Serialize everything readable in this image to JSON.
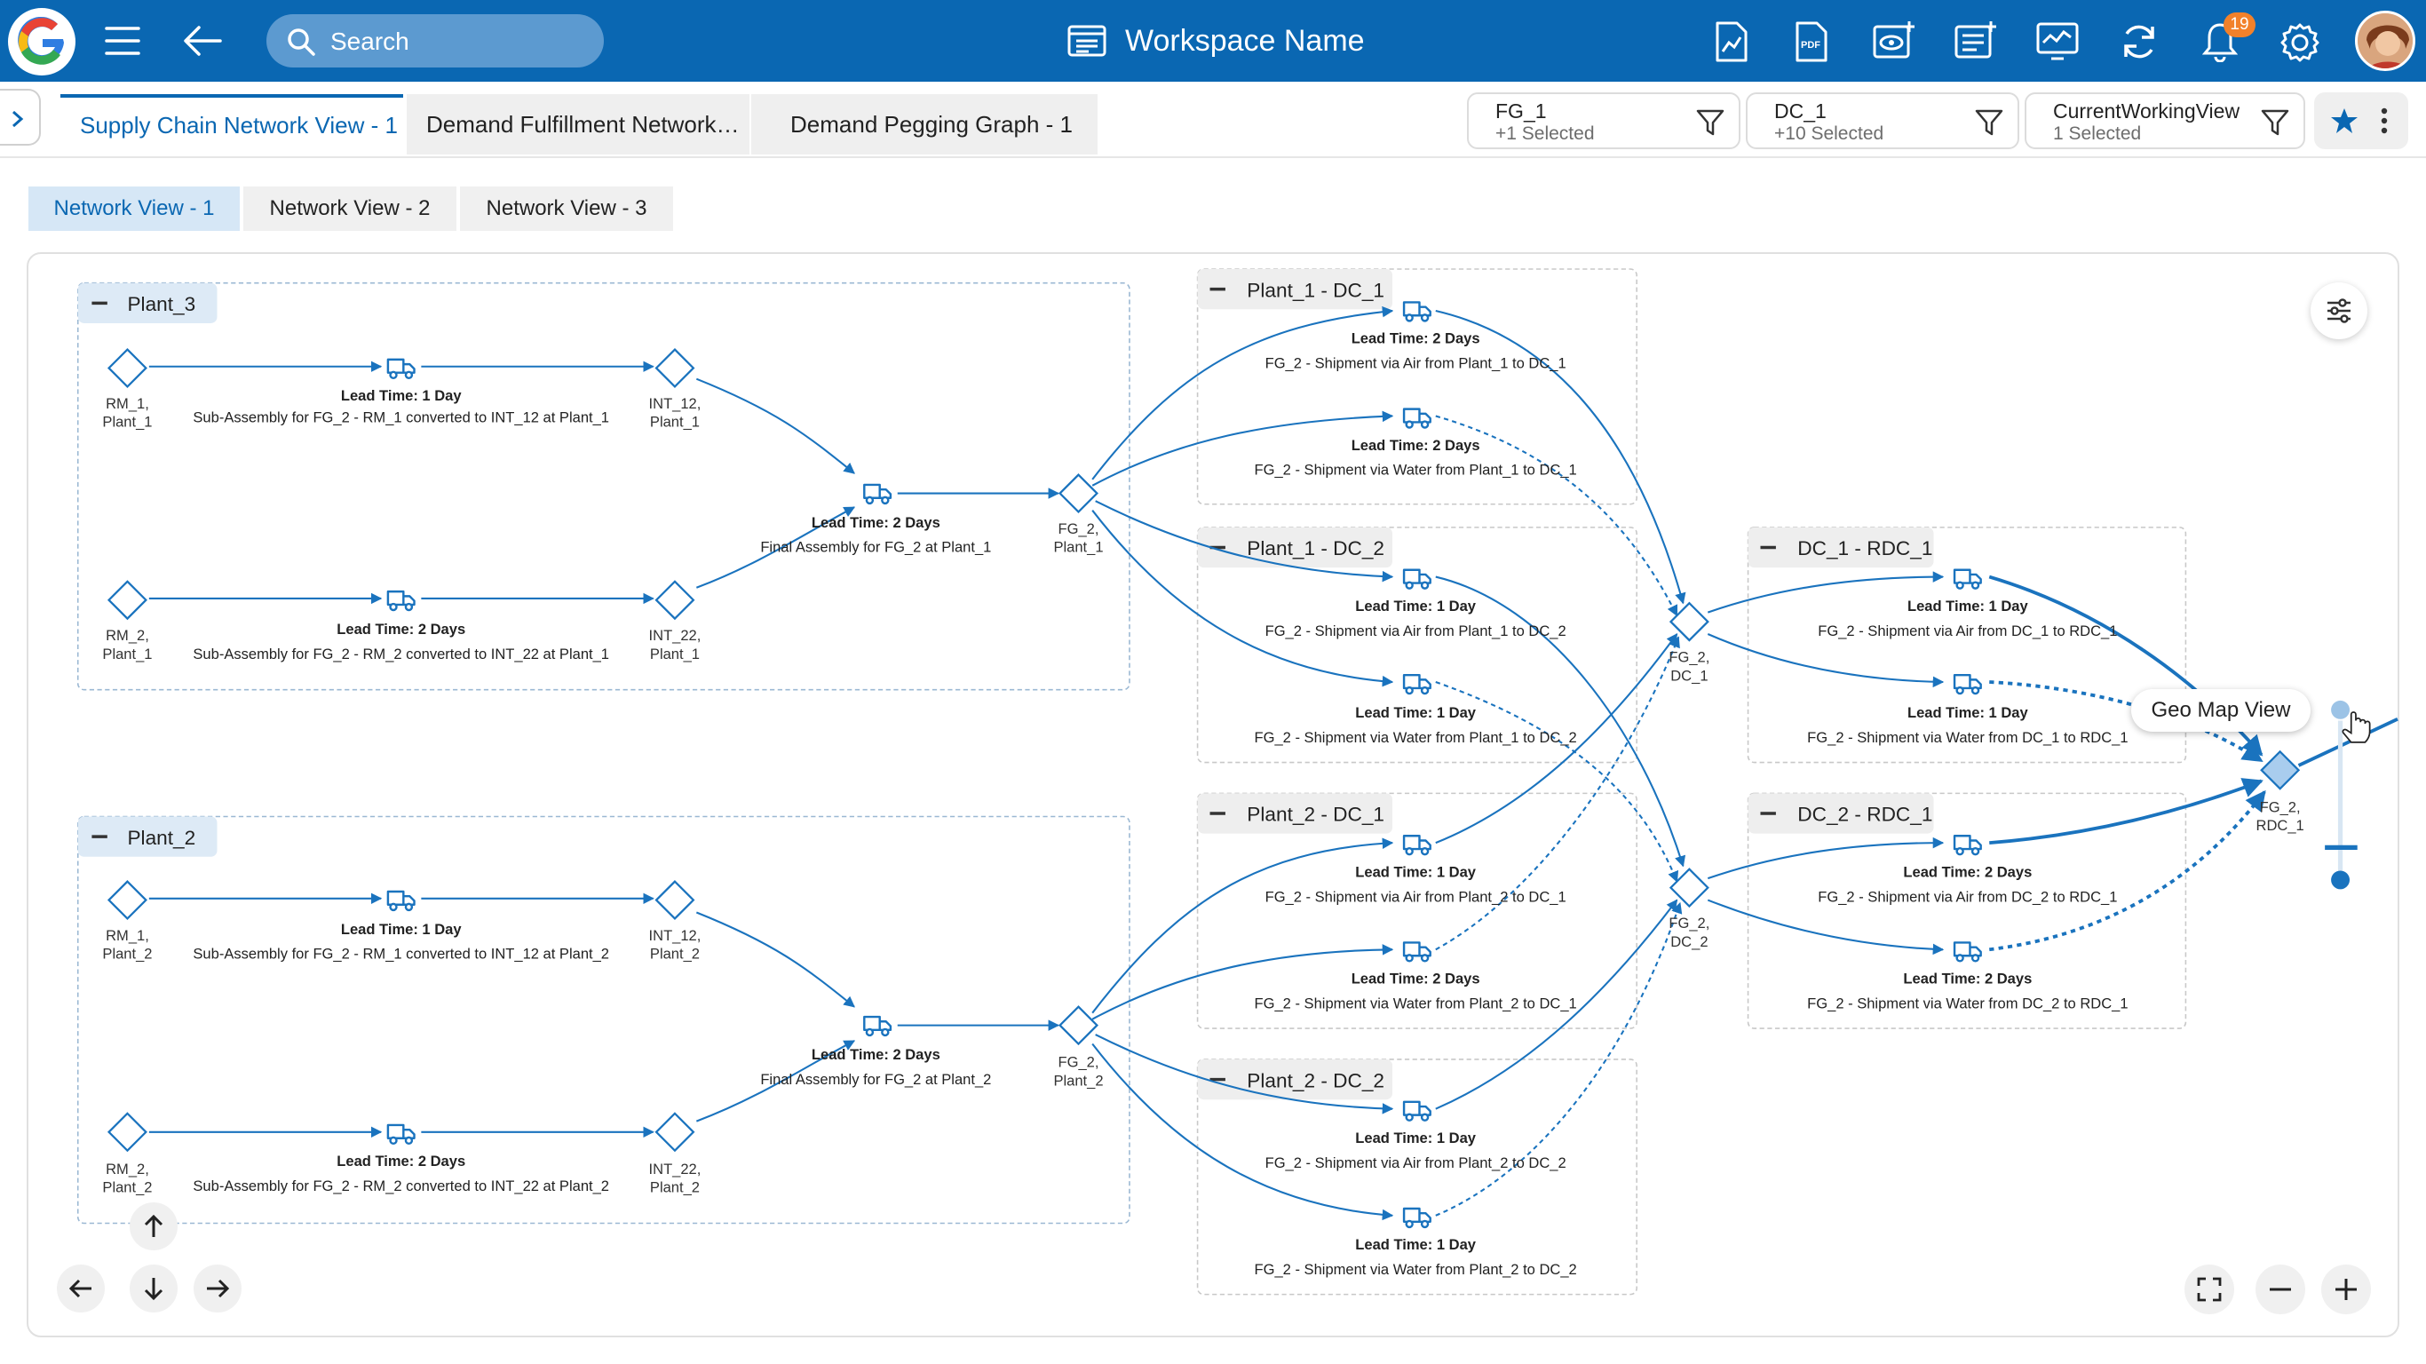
{
  "header": {
    "search_placeholder": "Search",
    "workspace_title": "Workspace Name",
    "notification_count": "19",
    "icons": [
      "menu-icon",
      "back-arrow-icon",
      "search-icon",
      "workspace-icon",
      "export-chart-icon",
      "pdf-icon",
      "preview-add-icon",
      "form-add-icon",
      "monitor-icon",
      "refresh-icon",
      "bell-icon",
      "settings-gear-icon"
    ]
  },
  "tabs": [
    {
      "label": "Supply Chain Network View - 1",
      "active": true
    },
    {
      "label": "Demand Fulfillment Network…",
      "active": false
    },
    {
      "label": "Demand Pegging Graph - 1",
      "active": false
    }
  ],
  "filters": [
    {
      "title": "FG_1",
      "subtitle": "+1 Selected"
    },
    {
      "title": "DC_1",
      "subtitle": "+10 Selected"
    },
    {
      "title": "CurrentWorkingView",
      "subtitle": "1 Selected"
    }
  ],
  "subtabs": [
    "Network View - 1",
    "Network View - 2",
    "Network View - 3"
  ],
  "colors": {
    "primary": "#0A67B2",
    "edge": "#1A73BE",
    "badge": "#F2812B"
  },
  "groups": [
    {
      "label": "Plant_3"
    },
    {
      "label": "Plant_2"
    },
    {
      "label": "Plant_1 - DC_1"
    },
    {
      "label": "Plant_1 - DC_2"
    },
    {
      "label": "Plant_2 - DC_1"
    },
    {
      "label": "Plant_2 - DC_2"
    },
    {
      "label": "DC_1 - RDC_1"
    },
    {
      "label": "DC_2 - RDC_1"
    }
  ],
  "nodes": [
    {
      "l1": "RM_1,",
      "l2": "Plant_1"
    },
    {
      "l1": "INT_12,",
      "l2": "Plant_1"
    },
    {
      "l1": "RM_2,",
      "l2": "Plant_1"
    },
    {
      "l1": "INT_22,",
      "l2": "Plant_1"
    },
    {
      "l1": "FG_2,",
      "l2": "Plant_1"
    },
    {
      "l1": "RM_1,",
      "l2": "Plant_2"
    },
    {
      "l1": "INT_12,",
      "l2": "Plant_2"
    },
    {
      "l1": "RM_2,",
      "l2": "Plant_2"
    },
    {
      "l1": "INT_22,",
      "l2": "Plant_2"
    },
    {
      "l1": "FG_2,",
      "l2": "Plant_2"
    },
    {
      "l1": "FG_2,",
      "l2": "DC_1"
    },
    {
      "l1": "FG_2,",
      "l2": "DC_2"
    },
    {
      "l1": "FG_2,",
      "l2": "RDC_1"
    }
  ],
  "activities": [
    {
      "lead": "Lead Time: 1 Day",
      "desc": "Sub-Assembly for FG_2 - RM_1 converted to INT_12 at Plant_1"
    },
    {
      "lead": "Lead Time: 2 Days",
      "desc": "Sub-Assembly for FG_2 - RM_2 converted to INT_22 at Plant_1"
    },
    {
      "lead": "Lead Time: 2 Days",
      "desc": "Final Assembly for FG_2 at Plant_1"
    },
    {
      "lead": "Lead Time: 1 Day",
      "desc": "Sub-Assembly for FG_2 - RM_1 converted to INT_12 at Plant_2"
    },
    {
      "lead": "Lead Time: 2 Days",
      "desc": "Sub-Assembly for FG_2 - RM_2 converted to INT_22 at Plant_2"
    },
    {
      "lead": "Lead Time: 2 Days",
      "desc": "Final Assembly for FG_2 at Plant_2"
    },
    {
      "lead": "Lead Time: 2 Days",
      "desc": "FG_2 - Shipment via Air from Plant_1 to DC_1"
    },
    {
      "lead": "Lead Time: 2 Days",
      "desc": "FG_2 - Shipment via Water from Plant_1 to DC_1"
    },
    {
      "lead": "Lead Time: 1 Day",
      "desc": "FG_2 - Shipment via Air from Plant_1 to DC_2"
    },
    {
      "lead": "Lead Time: 1 Day",
      "desc": "FG_2 - Shipment via Water from Plant_1 to DC_2"
    },
    {
      "lead": "Lead Time: 1 Day",
      "desc": "FG_2 - Shipment via Air from Plant_2 to DC_1"
    },
    {
      "lead": "Lead Time: 2 Days",
      "desc": "FG_2 - Shipment via Water from Plant_2 to DC_1"
    },
    {
      "lead": "Lead Time: 1 Day",
      "desc": "FG_2 - Shipment via Air from Plant_2 to DC_2"
    },
    {
      "lead": "Lead Time: 1 Day",
      "desc": "FG_2 - Shipment via Water from Plant_2 to DC_2"
    },
    {
      "lead": "Lead Time: 1 Day",
      "desc": "FG_2 - Shipment via Air from DC_1 to RDC_1"
    },
    {
      "lead": "Lead Time: 1 Day",
      "desc": "FG_2 - Shipment via Water from DC_1 to RDC_1"
    },
    {
      "lead": "Lead Time: 2 Days",
      "desc": "FG_2 - Shipment via Air from DC_2 to RDC_1"
    },
    {
      "lead": "Lead Time: 2 Days",
      "desc": "FG_2 - Shipment via Water from DC_2 to RDC_1"
    }
  ],
  "geo_tooltip": "Geo Map View"
}
